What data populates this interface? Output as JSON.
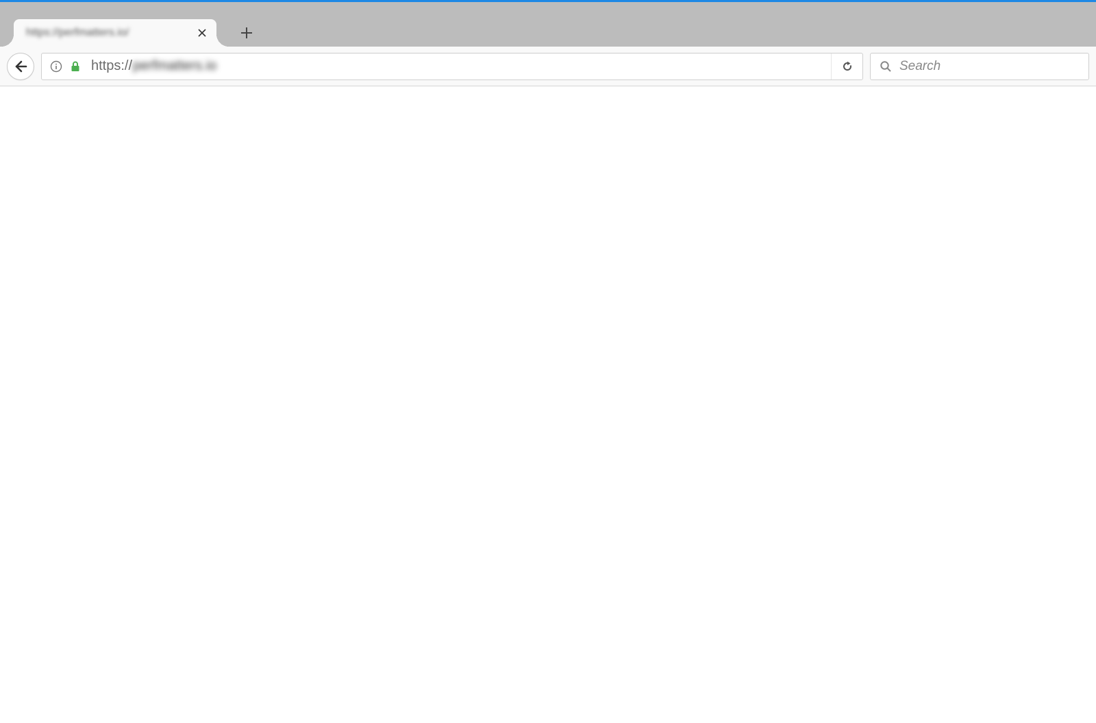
{
  "tab": {
    "title": "https://perfmatters.io/"
  },
  "address_bar": {
    "url_prefix": "https://",
    "url_domain": "perfmatters.io"
  },
  "search": {
    "placeholder": "Search",
    "value": ""
  }
}
